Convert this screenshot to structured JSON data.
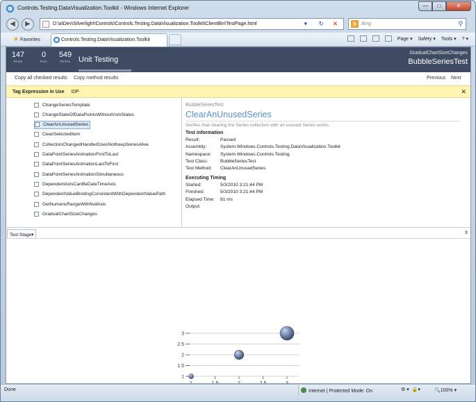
{
  "browser": {
    "window_title": "Controls.Testing.DataVisualization.Toolkit - Windows Internet Explorer",
    "window_buttons": {
      "minimize": "—",
      "maximize": "□",
      "close": "✕"
    },
    "address": "D:\\a\\Dev\\Silverlight\\Controls\\Controls.Testing.DataVisualization.Toolkit\\ClientBin\\TestPage.html",
    "search_placeholder": "Bing",
    "favorites_label": "Favorites",
    "tab_title": "Controls.Testing.DataVisualization.Toolkit",
    "commands": [
      "Page ▾",
      "Safety ▾",
      "Tools ▾",
      "? ▾"
    ],
    "status": "Done",
    "zone": "Internet | Protected Mode: On",
    "zoom": "100%"
  },
  "header": {
    "stats": [
      {
        "value": "147",
        "label": "PASS"
      },
      {
        "value": "0",
        "label": "FAIL"
      },
      {
        "value": "549",
        "label": "TOTAL"
      }
    ],
    "title": "Unit Testing",
    "right_small": "GradualChartSizeChanges",
    "right_large": "BubbleSeriesTest"
  },
  "toolbar": {
    "copy_all": "Copy all checked results",
    "copy_method": "Copy method results",
    "previous": "Previous",
    "next": "Next"
  },
  "tag_expression": {
    "label": "Tag Expression in Use",
    "value": "!DP",
    "close": "✕"
  },
  "tests": [
    "ChangeSeriesTemplate",
    "ChangeStateOfDataPointsWithoutVsmStates",
    "ClearAnUnusedSeries",
    "ClearSelectedItem",
    "CollectionChangedHandlerDoesNotKeepSeriesAlive",
    "DataPointSeriesAnimationFirstToLast",
    "DataPointSeriesAnimationLastToFirst",
    "DataPointSeriesAnimationSimultaneous",
    "DependentAxisCanBeDateTimeAxis",
    "DependentValueBindingConsistentWithDependentValuePath",
    "GetNumericRangeWithNullAxis",
    "GradualChartSizeChanges"
  ],
  "selected_test_index": 2,
  "detail": {
    "crumb": "BubbleSeriesTest",
    "title": "ClearAnUnusedSeries",
    "description": "Verifies that clearing the Series collection with an unused Series works.",
    "info_heading": "Test information",
    "info": [
      {
        "key": "Result:",
        "value": "Passed"
      },
      {
        "key": "Assembly:",
        "value": "System.Windows.Controls.Testing.DataVisualization.Toolkit"
      },
      {
        "key": "Namespace:",
        "value": "System.Windows.Controls.Testing"
      },
      {
        "key": "Test Class:",
        "value": "BubbleSeriesTest"
      },
      {
        "key": "Test Method:",
        "value": "ClearAnUnusedSeries"
      }
    ],
    "timing_heading": "Executing Timing",
    "timing": [
      {
        "key": "Started:",
        "value": "5/3/2010 3:21:44 PM"
      },
      {
        "key": "Finished:",
        "value": "5/3/2010 3:21:44 PM"
      },
      {
        "key": "Elapsed Time:",
        "value": "81 ms"
      },
      {
        "key": "Output:",
        "value": ""
      }
    ]
  },
  "stage": {
    "label": "Test Stage▾",
    "pause": "II"
  },
  "chart_data": {
    "type": "scatter",
    "bubble": true,
    "points": [
      {
        "x": 1,
        "y": 1,
        "size": 1
      },
      {
        "x": 2,
        "y": 2,
        "size": 2
      },
      {
        "x": 3,
        "y": 3,
        "size": 3
      }
    ],
    "x_ticks": [
      "1",
      "1.5",
      "2",
      "2.5",
      "3"
    ],
    "y_ticks": [
      "1",
      "1.5",
      "2",
      "2.5",
      "3"
    ],
    "xlim": [
      1,
      3
    ],
    "ylim": [
      1,
      3
    ],
    "grid": true,
    "color": "#5b6f95"
  }
}
